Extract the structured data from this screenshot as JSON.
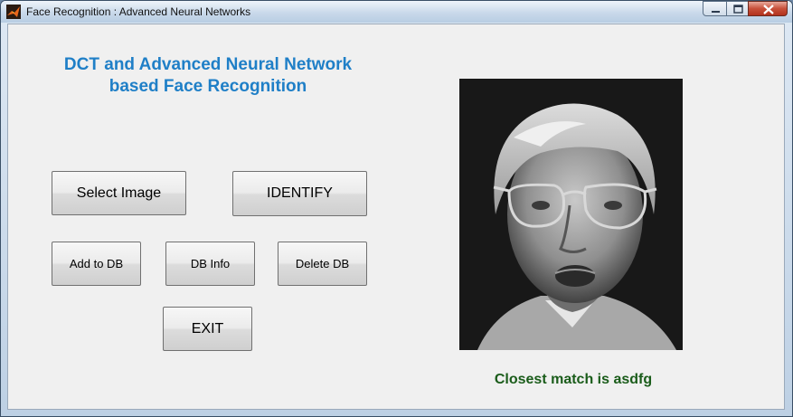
{
  "window": {
    "title": "Face Recognition : Advanced Neural Networks",
    "icon": "matlab-icon",
    "controls": [
      "minimize-icon",
      "maximize-icon",
      "close-icon"
    ]
  },
  "main": {
    "heading_line1": "DCT and Advanced Neural Network",
    "heading_line2": "based Face Recognition",
    "buttons": {
      "select_image": "Select Image",
      "identify": "IDENTIFY",
      "add_to_db": "Add to DB",
      "db_info": "DB Info",
      "delete_db": "Delete DB",
      "exit": "EXIT"
    },
    "result_text": "Closest match is asdfg"
  },
  "colors": {
    "heading": "#1f7fc7",
    "result": "#1a5c1a",
    "panel_bg": "#f0f0f0"
  }
}
